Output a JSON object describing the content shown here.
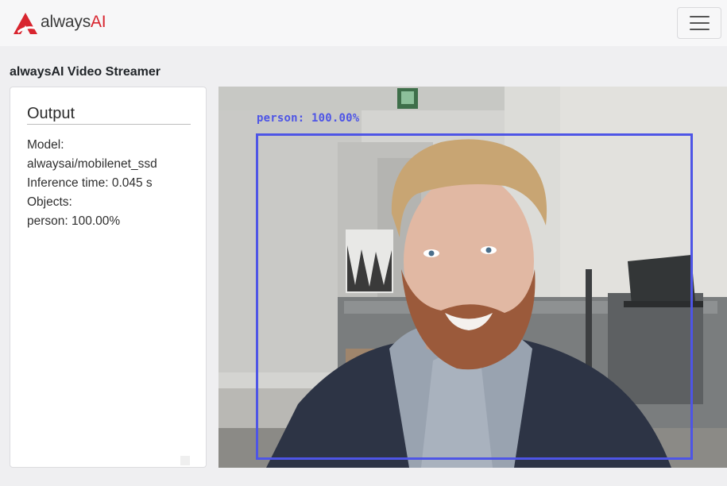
{
  "header": {
    "brand_word1": "always",
    "brand_word2": "AI",
    "brand_color": "#d8252f",
    "menu_icon": "hamburger-menu-icon"
  },
  "page": {
    "title": "alwaysAI Video Streamer"
  },
  "output": {
    "heading": "Output",
    "lines": [
      "Model:",
      "alwaysai/mobilenet_ssd",
      "Inference time: 0.045 s",
      "Objects:",
      "person: 100.00%"
    ]
  },
  "video": {
    "detection": {
      "label": "person: 100.00%",
      "box_color": "#4e55e6"
    }
  }
}
